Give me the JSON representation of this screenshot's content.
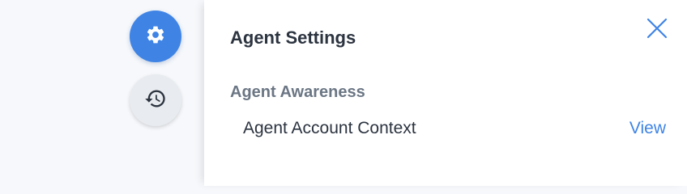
{
  "rail": {
    "settings_icon": "gear-icon",
    "history_icon": "history-icon",
    "active_color": "#3f84e5"
  },
  "panel": {
    "title": "Agent Settings",
    "close_icon": "close-icon",
    "section": {
      "title": "Agent Awareness",
      "items": [
        {
          "label": "Agent Account Context",
          "action": "View"
        }
      ]
    }
  },
  "colors": {
    "accent": "#3f84e5",
    "text_primary": "#2c3440",
    "text_secondary": "#6b7684"
  }
}
